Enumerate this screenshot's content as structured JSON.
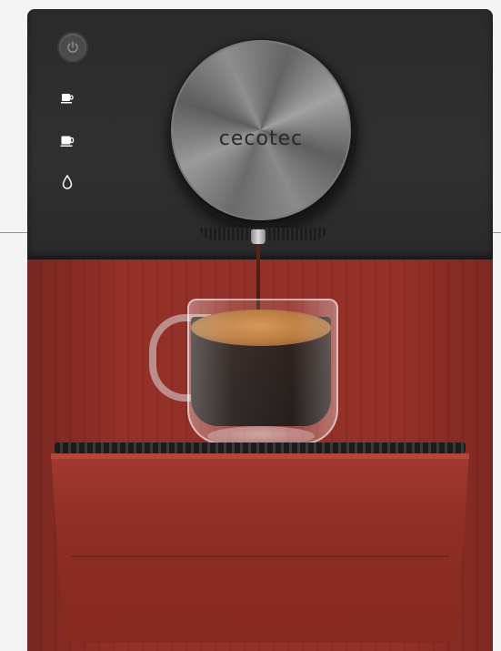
{
  "machine": {
    "brand": "cecotec",
    "controls": [
      {
        "name": "power",
        "icon": "power-icon",
        "interactable": true
      },
      {
        "name": "espresso",
        "icon": "small-cup-icon",
        "interactable": true
      },
      {
        "name": "lungo",
        "icon": "large-cup-icon",
        "interactable": true
      },
      {
        "name": "hot-water",
        "icon": "water-drop-icon",
        "interactable": true
      }
    ],
    "colors": {
      "top_panel": "#2b2b2b",
      "body": "#933028",
      "accent_line": "#3fb3c8",
      "coffee": "#1a0c08",
      "crema": "#c27a36"
    }
  }
}
